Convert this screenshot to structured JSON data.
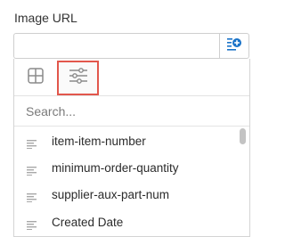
{
  "field": {
    "label": "Image URL",
    "value": "",
    "placeholder": ""
  },
  "insert_button": {
    "icon": "insert-field-icon",
    "accent": "#1a73c8"
  },
  "dropdown": {
    "tabs": [
      {
        "icon": "grid-icon",
        "selected": false
      },
      {
        "icon": "sliders-icon",
        "selected": true
      }
    ],
    "search_placeholder": "Search...",
    "items": [
      {
        "label": "item-item-number",
        "icon": "text-field-icon"
      },
      {
        "label": "minimum-order-quantity",
        "icon": "text-field-icon"
      },
      {
        "label": "supplier-aux-part-num",
        "icon": "text-field-icon"
      },
      {
        "label": "Created Date",
        "icon": "text-field-icon"
      }
    ],
    "highlight_color": "#e2574c"
  }
}
